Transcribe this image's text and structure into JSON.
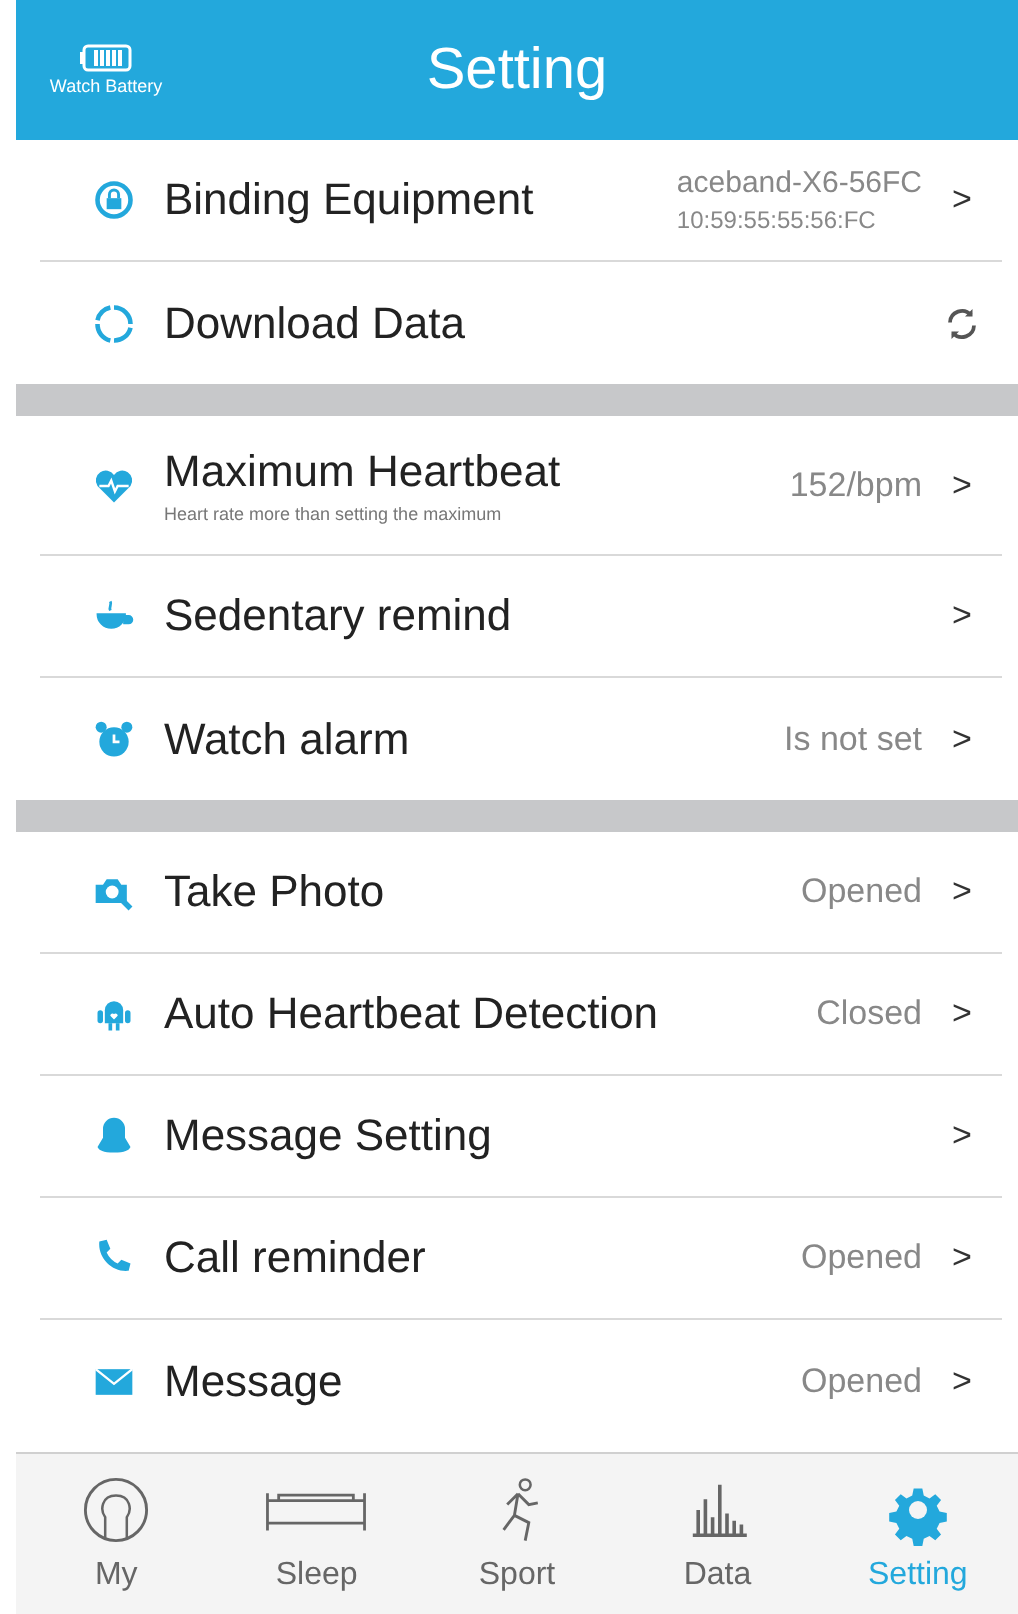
{
  "header": {
    "battery_label": "Watch Battery",
    "title": "Setting"
  },
  "sections": [
    [
      {
        "kind": "lock",
        "label": "Binding Equipment",
        "value": "aceband-X6-56FC",
        "value_sub": "10:59:55:55:56:FC",
        "arrow": ">"
      },
      {
        "kind": "sync",
        "label": "Download Data"
      }
    ],
    [
      {
        "kind": "heart",
        "label": "Maximum Heartbeat",
        "subtitle": "Heart rate more than setting the maximum",
        "value": "152/bpm",
        "arrow": ">"
      },
      {
        "kind": "cup",
        "label": "Sedentary remind",
        "arrow": ">"
      },
      {
        "kind": "alarm",
        "label": "Watch alarm",
        "value": "Is not set",
        "arrow": ">"
      }
    ],
    [
      {
        "kind": "camera",
        "label": "Take Photo",
        "value": "Opened",
        "arrow": ">"
      },
      {
        "kind": "robot",
        "label": "Auto Heartbeat Detection",
        "value": "Closed",
        "arrow": ">"
      },
      {
        "kind": "bell",
        "label": "Message Setting",
        "arrow": ">"
      },
      {
        "kind": "phone",
        "label": "Call reminder",
        "value": "Opened",
        "arrow": ">"
      },
      {
        "kind": "mail",
        "label": "Message",
        "value": "Opened",
        "arrow": ">"
      }
    ]
  ],
  "tabs": [
    {
      "label": "My",
      "selected": false
    },
    {
      "label": "Sleep",
      "selected": false
    },
    {
      "label": "Sport",
      "selected": false
    },
    {
      "label": "Data",
      "selected": false
    },
    {
      "label": "Setting",
      "selected": true
    }
  ]
}
